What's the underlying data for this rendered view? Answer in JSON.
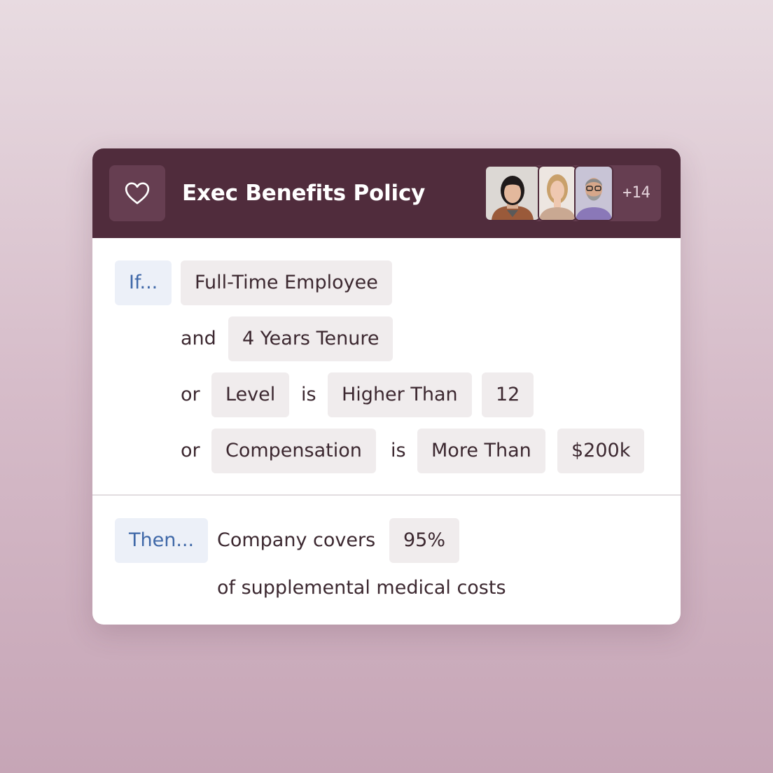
{
  "header": {
    "title": "Exec Benefits Policy",
    "icon": "heart-icon",
    "avatars": [
      "Team member 1",
      "Team member 2",
      "Team member 3"
    ],
    "more_count": "+14"
  },
  "condition": {
    "if_label": "If...",
    "rows": [
      {
        "chip": "Full-Time Employee"
      },
      {
        "connector": "and",
        "chip": "4 Years Tenure"
      },
      {
        "connector": "or",
        "field": "Level",
        "op_word": "is",
        "operator": "Higher Than",
        "value": "12"
      },
      {
        "connector": "or",
        "field": "Compensation",
        "op_word": "is",
        "operator": "More Than",
        "value": "$200k"
      }
    ]
  },
  "action": {
    "then_label": "Then...",
    "text": "Company covers",
    "value": "95%",
    "suffix": "of supplemental medical costs"
  },
  "colors": {
    "header_bg": "#502c3c",
    "header_button_bg": "#663e51",
    "chip_bg": "#f0eced",
    "keyword_bg": "#ecf0f8",
    "keyword_text": "#3f68a8",
    "body_text": "#3c2830"
  }
}
